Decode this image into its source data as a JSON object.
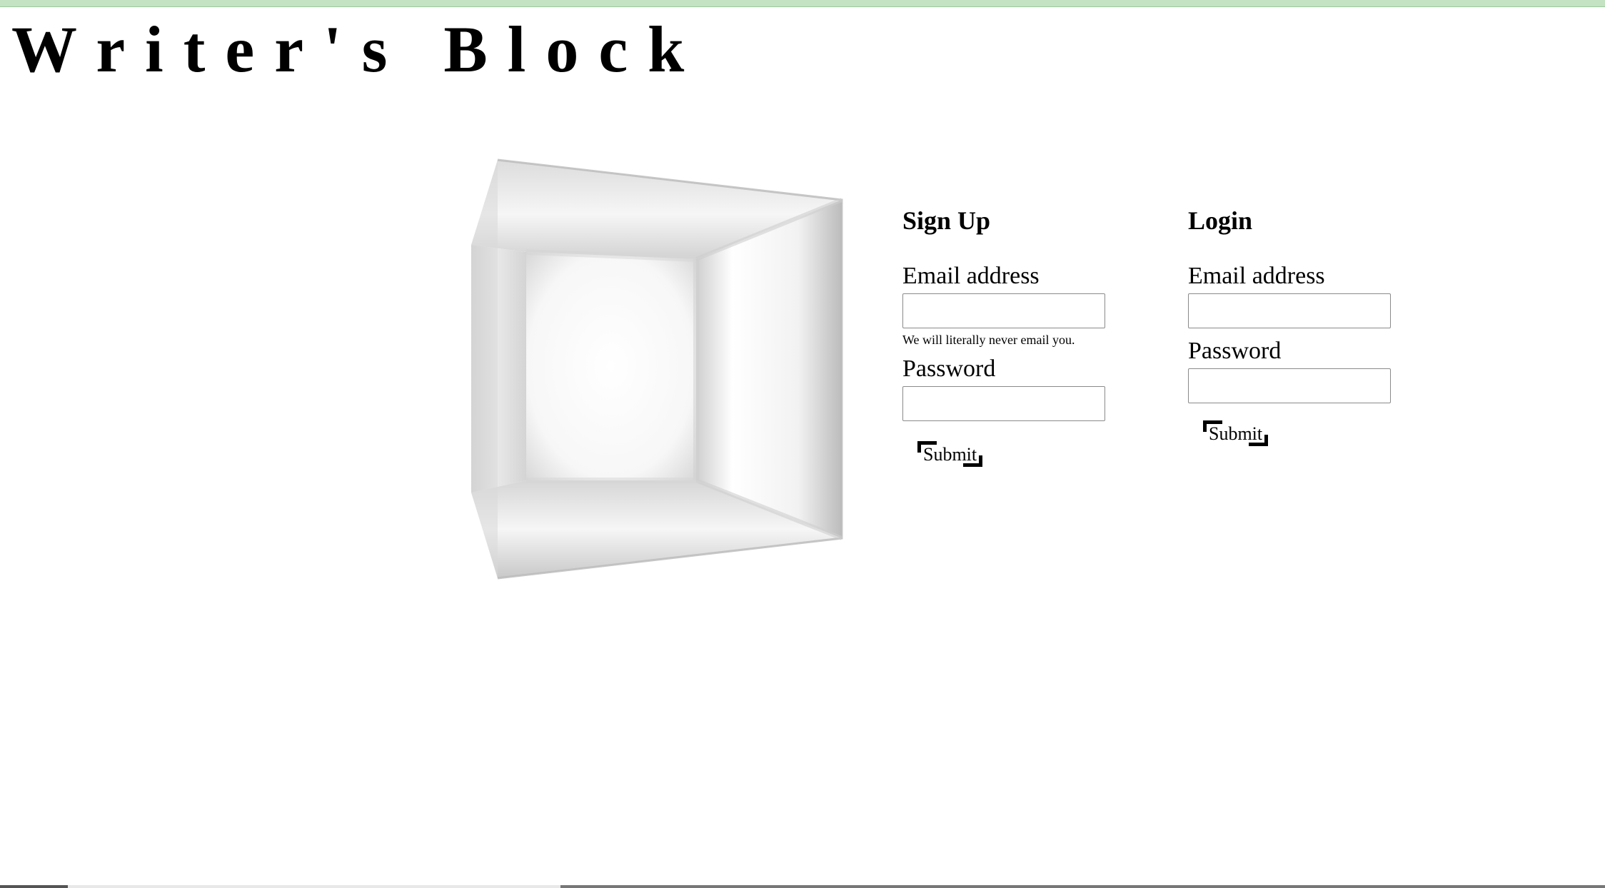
{
  "header": {
    "title": "Writer's Block"
  },
  "colors": {
    "top_bar": "#c3e3c3",
    "background": "#ffffff",
    "text": "#000000",
    "cube_face": "#f4f4f4",
    "cube_edge": "#bdbdbd"
  },
  "signup": {
    "heading": "Sign Up",
    "email_label": "Email address",
    "email_value": "",
    "email_help": "We will literally never email you.",
    "password_label": "Password",
    "password_value": "",
    "submit_label": "Submit"
  },
  "login": {
    "heading": "Login",
    "email_label": "Email address",
    "email_value": "",
    "password_label": "Password",
    "password_value": "",
    "submit_label": "Submit"
  },
  "icons": {
    "decoration": "3d-cube-room-icon",
    "button_corners": "bracket-corner-icon"
  }
}
